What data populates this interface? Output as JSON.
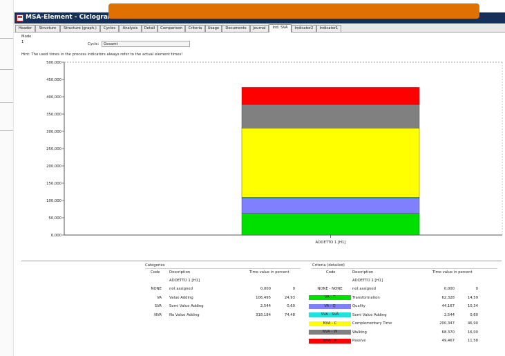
{
  "window": {
    "title": "MSA-Element - Ciclogramma"
  },
  "tabs": [
    {
      "label": "Header",
      "active": false
    },
    {
      "label": "Structure",
      "active": false
    },
    {
      "label": "Structure (graph.)",
      "active": false
    },
    {
      "label": "Cycles",
      "active": false
    },
    {
      "label": "Analysis",
      "active": false
    },
    {
      "label": "Detail",
      "active": false
    },
    {
      "label": "Comparison",
      "active": false
    },
    {
      "label": "Criteria",
      "active": false
    },
    {
      "label": "Usage",
      "active": false
    },
    {
      "label": "Documents",
      "active": false
    },
    {
      "label": "Journal",
      "active": false
    },
    {
      "label": "Ind. SVA",
      "active": true
    },
    {
      "label": "Indicator2",
      "active": false
    },
    {
      "label": "Indicator1",
      "active": false
    }
  ],
  "mode": {
    "label": "Mode",
    "value": "1"
  },
  "cycle": {
    "label": "Cycle:",
    "value": "Gesamt"
  },
  "hint": "Hint: The used times in the process indicators always refer to the actual element times!",
  "chart_data": {
    "type": "bar",
    "stacked": true,
    "categories": [
      "ADDETTO 1 [H1]"
    ],
    "series": [
      {
        "values": [
          62328
        ],
        "color": "#00e000"
      },
      {
        "values": [
          44167
        ],
        "color": "#8080ff"
      },
      {
        "values": [
          2544
        ],
        "color": "#20c0e0"
      },
      {
        "values": [
          200347
        ],
        "color": "#ffff00"
      },
      {
        "values": [
          68370
        ],
        "color": "#808080"
      },
      {
        "values": [
          49467
        ],
        "color": "#ff0000"
      }
    ],
    "yticks": [
      "0,000",
      "50,000",
      "100,000",
      "150,000",
      "200,000",
      "250,000",
      "300,000",
      "350,000",
      "400,000",
      "450,000",
      "500,000"
    ],
    "ylim": [
      0,
      500000
    ],
    "grid": false
  },
  "categories_table": {
    "title": "Categories",
    "headers": {
      "code": "Code",
      "description": "Description",
      "time": "Time value in percent"
    },
    "subheader": "ADDETTO 1 [H1]",
    "rows": [
      {
        "code": "NONE",
        "description": "not assigned",
        "value": "0,000",
        "percent": "0"
      },
      {
        "code": "VA",
        "description": "Value Adding",
        "value": "106,495",
        "percent": "24,93"
      },
      {
        "code": "SVA",
        "description": "Semi Value Adding",
        "value": "2,544",
        "percent": "0,60"
      },
      {
        "code": "NVA",
        "description": "No Value Adding",
        "value": "318,184",
        "percent": "74,48"
      }
    ]
  },
  "criteria_table": {
    "title": "Criteria (detailed)",
    "headers": {
      "code": "Code",
      "description": "Description",
      "time": "Time value in percent"
    },
    "subheader": "ADDETTO 1 [H1]",
    "rows": [
      {
        "code": "NONE - NONE",
        "description": "not assigned",
        "value": "0,000",
        "percent": "0",
        "color": "#ffffff"
      },
      {
        "code": "VA - T",
        "description": "Transformation",
        "value": "62,328",
        "percent": "14,59",
        "color": "#00e000"
      },
      {
        "code": "VA - Q",
        "description": "Quality",
        "value": "44,167",
        "percent": "10,34",
        "color": "#8080ff"
      },
      {
        "code": "SVA - SVA",
        "description": "Semi Value Adding",
        "value": "2,544",
        "percent": "0,60",
        "color": "#20e0e0"
      },
      {
        "code": "NVA - C",
        "description": "Complementary Time",
        "value": "200,347",
        "percent": "46,90",
        "color": "#ffff00"
      },
      {
        "code": "NVA - W",
        "description": "Walking",
        "value": "68,370",
        "percent": "16,00",
        "color": "#808080"
      },
      {
        "code": "NVA - P",
        "description": "Passive",
        "value": "49,467",
        "percent": "11,58",
        "color": "#ff0000"
      }
    ]
  }
}
